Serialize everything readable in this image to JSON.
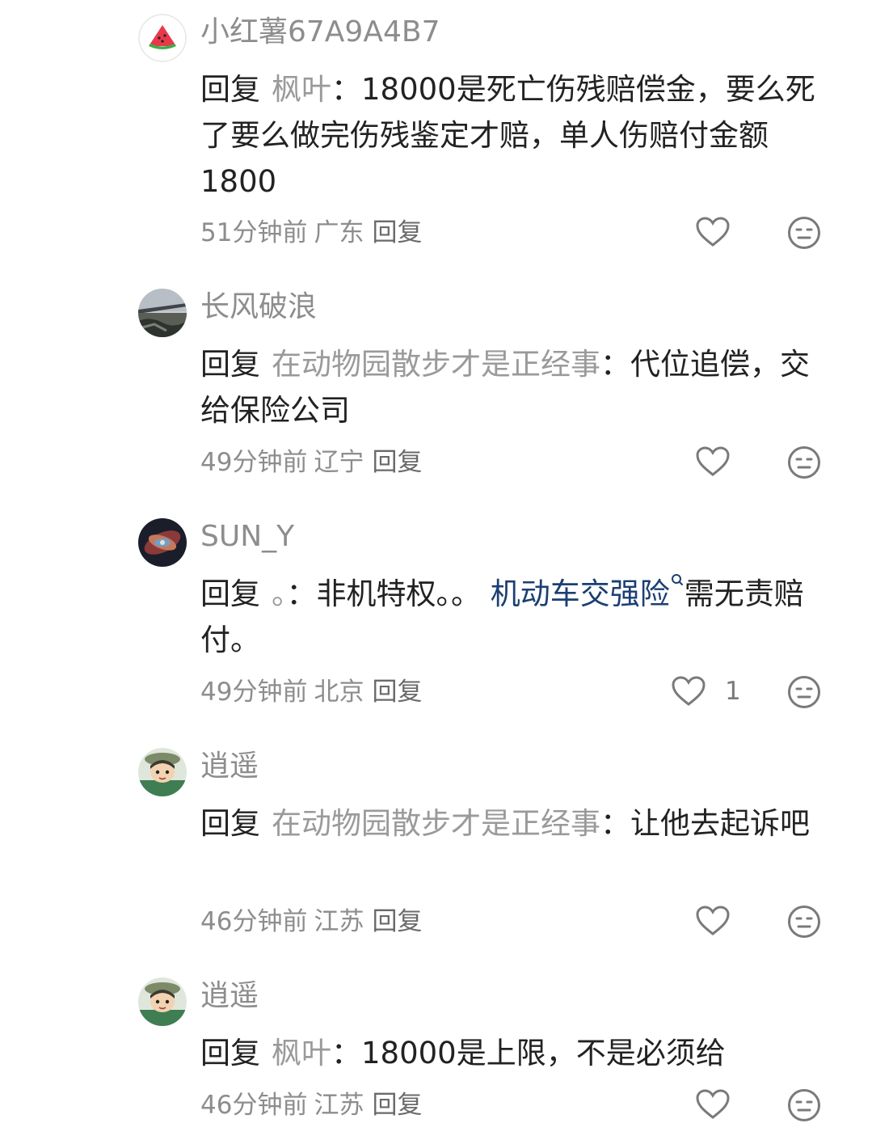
{
  "comments": [
    {
      "username": "小红薯67A9A4B7",
      "avatar": "watermelon-icon",
      "reply_prefix": "回复",
      "reply_target": "枫叶",
      "separator": "：",
      "text": "18000是死亡伤残赔偿金，要么死了要么做完伤残鉴定才赔，单人伤赔付金额1800",
      "time": "51分钟前",
      "location": "广东",
      "reply_label": "回复",
      "likes": ""
    },
    {
      "username": "长风破浪",
      "avatar": "bridge-photo-avatar",
      "reply_prefix": "回复",
      "reply_target": "在动物园散步才是正经事",
      "separator": "：",
      "text": "代位追偿，交给保险公司",
      "time": "49分钟前",
      "location": "辽宁",
      "reply_label": "回复",
      "likes": ""
    },
    {
      "username": "SUN_Y",
      "avatar": "nebula-avatar",
      "reply_prefix": "回复",
      "reply_target": "。",
      "separator": "：",
      "text_before": "非机特权。。",
      "link_text": "机动车交强险",
      "text_after": "需无责赔付。",
      "time": "49分钟前",
      "location": "北京",
      "reply_label": "回复",
      "likes": "1"
    },
    {
      "username": "逍遥",
      "avatar": "cartoon-boy-avatar",
      "reply_prefix": "回复",
      "reply_target": "在动物园散步才是正经事",
      "separator": "：",
      "text": "让他去起诉吧",
      "time": "46分钟前",
      "location": "江苏",
      "reply_label": "回复",
      "likes": ""
    },
    {
      "username": "逍遥",
      "avatar": "cartoon-boy-avatar",
      "reply_prefix": "回复",
      "reply_target": "枫叶",
      "separator": "：",
      "text": "18000是上限，不是必须给",
      "time": "46分钟前",
      "location": "江苏",
      "reply_label": "回复",
      "likes": ""
    }
  ],
  "colors": {
    "link": "#1b3f73",
    "muted": "#8d8d8d",
    "text": "#222222"
  }
}
